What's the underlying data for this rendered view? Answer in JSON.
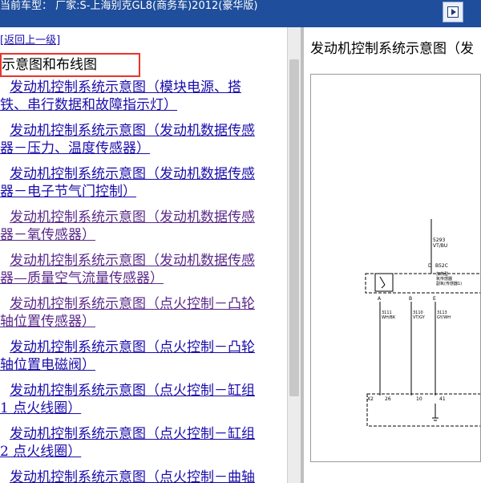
{
  "header": {
    "title": "当前车型：  厂家:S-上海别克GL8(商务车)2012(豪华版)",
    "button_icon": "expand-arrow-icon"
  },
  "left": {
    "back_label": "[返回上一级]",
    "section_title": "示意图和布线图",
    "links": [
      {
        "line1": "发动机控制系统示意图（模块电源、搭",
        "line2": "铁、串行数据和故障指示灯）",
        "visited": false
      },
      {
        "line1": "发动机控制系统示意图（发动机数据传感",
        "line2": "器－压力、温度传感器）",
        "visited": false
      },
      {
        "line1": "发动机控制系统示意图（发动机数据传感",
        "line2": "器－电子节气门控制）",
        "visited": false
      },
      {
        "line1": "发动机控制系统示意图（发动机数据传感",
        "line2": "器－氧传感器）",
        "visited": true
      },
      {
        "line1": "发动机控制系统示意图（发动机数据传感",
        "line2": "器—质量空气流量传感器）",
        "visited": true
      },
      {
        "line1": "发动机控制系统示意图（点火控制－凸轮",
        "line2": "轴位置传感器）",
        "visited": true
      },
      {
        "line1": "发动机控制系统示意图（点火控制－凸轮",
        "line2": "轴位置电磁阀）",
        "visited": false
      },
      {
        "line1": "发动机控制系统示意图（点火控制－缸组",
        "line2": "1 点火线圈）",
        "visited": false
      },
      {
        "line1": "发动机控制系统示意图（点火控制－缸组",
        "line2": "2 点火线圈）",
        "visited": false
      },
      {
        "line1": "发动机控制系统示意图（点火控制－曲轴",
        "line2": "",
        "visited": false
      }
    ]
  },
  "right": {
    "title": "发动机控制系统示意图（发",
    "diagram_labels": {
      "wire_top": "5293",
      "wire_top_color": "VT/BU",
      "connector": "B52C",
      "pin_d": "D",
      "sensor_name1": "加热型",
      "sensor_name2": "氧传感器",
      "sensor_name3": "副氧(传感器1)",
      "pin_a": "A",
      "pin_b": "B",
      "pin_e": "E",
      "wire_a": "3111",
      "wire_a_color": "WH/BK",
      "wire_b": "3110",
      "wire_b_color": "VT/GY",
      "wire_e": "3113",
      "wire_e_color": "GY/WH",
      "x2": "X2",
      "pin_26": "26",
      "pin_10": "10",
      "pin_41": "41"
    }
  }
}
